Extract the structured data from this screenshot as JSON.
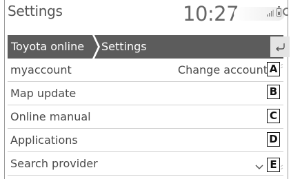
{
  "header": {
    "title": "Settings",
    "clock": "10:27"
  },
  "breadcrumb": {
    "items": [
      "Toyota online",
      "Settings"
    ]
  },
  "rows": [
    {
      "label": "myaccount",
      "value": "Change account",
      "marker": "A"
    },
    {
      "label": "Map update",
      "value": "",
      "marker": "B"
    },
    {
      "label": "Online manual",
      "value": "",
      "marker": "C"
    },
    {
      "label": "Applications",
      "value": "",
      "marker": "D"
    },
    {
      "label": "Search provider",
      "value": "",
      "marker": "E"
    }
  ],
  "icons": {
    "signal": "signal-icon",
    "battery": "battery-icon",
    "back": "back-arrow-icon",
    "dropdown": "chevron-down-icon"
  },
  "colors": {
    "crumb_bar": "#5c5c5c",
    "crumb_text": "#ffffff",
    "back_button": "#e4e4e4",
    "row_divider": "#cfcfcf"
  }
}
